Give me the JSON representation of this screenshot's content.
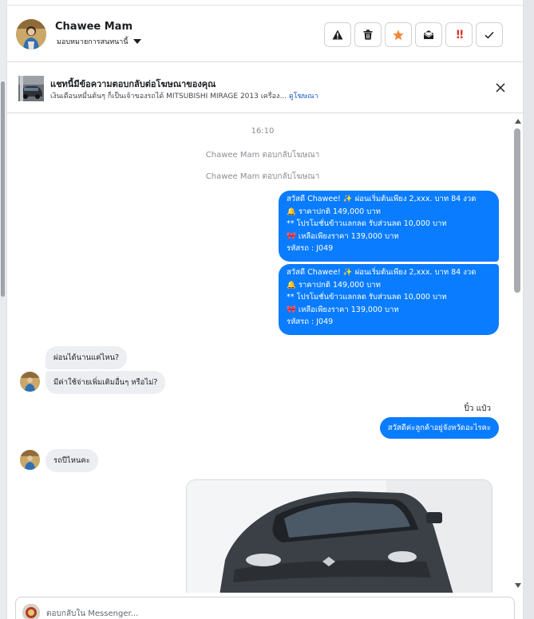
{
  "colors": {
    "accent_blue": "#0a7cff",
    "incoming_bubble": "#eceef1",
    "link_blue": "#1458c9",
    "star_orange": "#f0883a",
    "alert_red": "#e0332b"
  },
  "header": {
    "contact_name": "Chawee Mam",
    "assign_label": "มอบหมายการสนทนานี้",
    "actions": [
      {
        "name": "warning-button",
        "icon": "warning-triangle-icon"
      },
      {
        "name": "delete-button",
        "icon": "trash-icon"
      },
      {
        "name": "star-button",
        "icon": "star-icon"
      },
      {
        "name": "mark-unread-button",
        "icon": "open-envelope-icon"
      },
      {
        "name": "mark-urgent-button",
        "icon": "double-exclamation-icon",
        "text": "!!"
      },
      {
        "name": "mark-done-button",
        "icon": "checkmark-icon"
      }
    ]
  },
  "ad_banner": {
    "title": "แชทนี้มีข้อความตอบกลับต่อโฆษณาของคุณ",
    "description": "เงินเดือนหมื่นต้นๆ ก็เป็นเจ้าของรถได้ MITSUBISHI MIRAGE 2013 เครื่อง...",
    "link_label": "ดูโฆษณา"
  },
  "chat": {
    "timestamp": "16:10",
    "system_messages": [
      "Chawee Mam ตอบกลับโฆษณา",
      "Chawee Mam ตอบกลับโฆษณา"
    ],
    "outgoing_promos": [
      {
        "line1": "สวัสดี Chawee! ✨  ผ่อนเริ่มต้นเพียง 2,xxx. บาท 84 งวด",
        "line2": "🔔 ราคาปกติ 149,000 บาท",
        "line3": "** โปรโมชั่นข้าวแลกลด รับส่วนลด 10,000 บาท",
        "line4": "🎀  เหลือเพียงราคา 139,000 บาท",
        "line5": " รหัสรถ : J049"
      },
      {
        "line1": "สวัสดี Chawee! ✨  ผ่อนเริ่มต้นเพียง 2,xxx. บาท 84 งวด",
        "line2": "🔔 ราคาปกติ 149,000 บาท",
        "line3": "** โปรโมชั่นข้าวแลกลด รับส่วนลด 10,000 บาท",
        "line4": "🎀  เหลือเพียงราคา 139,000 บาท",
        "line5": " รหัสรถ : J049"
      }
    ],
    "incoming": [
      "ผ่อนได้นานแค่ไหน?",
      "มีค่าใช้จ่ายเพิ่มเติมอื่นๆ หรือไม่?",
      "รถปีไหนคะ"
    ],
    "agent_name": "ปิ๋ว แป๋ว",
    "agent_reply": "สวัสดีค่ะลูกค้าอยู่จังหวัดอะไรคะ"
  },
  "composer": {
    "placeholder": "ตอบกลับใน Messenger..."
  }
}
